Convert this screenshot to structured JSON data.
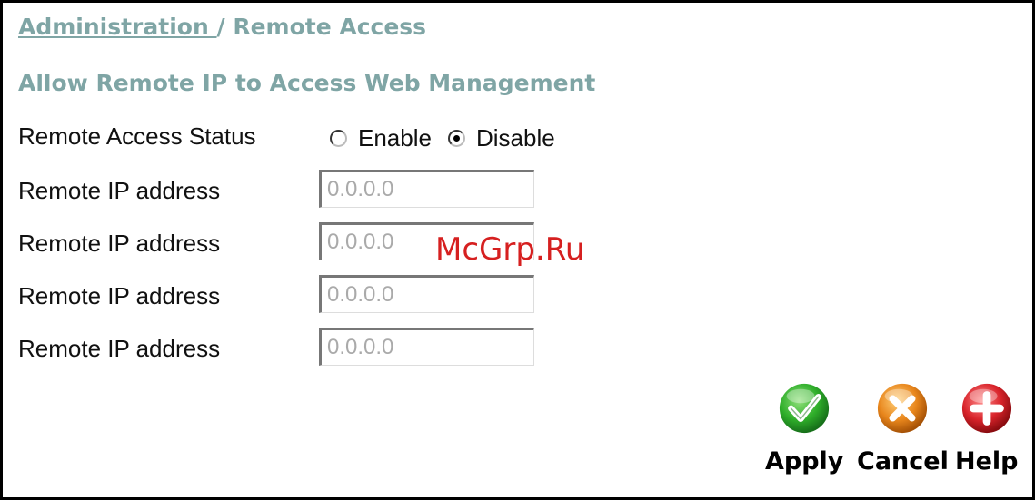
{
  "breadcrumb": {
    "parent": "Administration ",
    "separator": "/ ",
    "current": "Remote Access"
  },
  "section_title": "Allow Remote IP to Access Web Management",
  "remote_access_status": {
    "label": "Remote Access Status",
    "options": [
      {
        "label": "Enable",
        "checked": false
      },
      {
        "label": "Disable",
        "checked": true
      }
    ]
  },
  "remote_ips": [
    {
      "label": "Remote IP address",
      "value": "0.0.0.0"
    },
    {
      "label": "Remote IP address",
      "value": "0.0.0.0"
    },
    {
      "label": "Remote IP address",
      "value": "0.0.0.0"
    },
    {
      "label": "Remote IP address",
      "value": "0.0.0.0"
    }
  ],
  "watermark": "McGrp.Ru",
  "actions": {
    "apply": {
      "label": "Apply",
      "icon": "checkmark-icon",
      "color": "#2fae2a"
    },
    "cancel": {
      "label": "Cancel",
      "icon": "x-icon",
      "color": "#e8861c"
    },
    "help": {
      "label": "Help",
      "icon": "plus-icon",
      "color": "#d8232a"
    }
  },
  "colors": {
    "heading": "#7fa5a5",
    "watermark": "#d62020"
  }
}
